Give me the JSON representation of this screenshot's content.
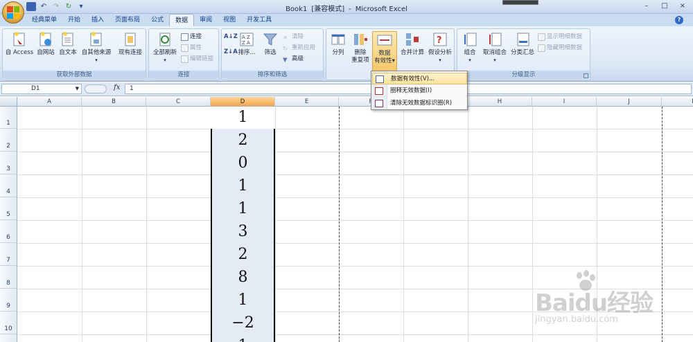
{
  "window": {
    "title_book": "Book1",
    "title_mode": "[兼容模式]",
    "title_sep": "-",
    "title_app": "Microsoft Excel",
    "controls": [
      "–",
      "□",
      "×"
    ]
  },
  "tabs": [
    {
      "label": "经典菜单",
      "active": false
    },
    {
      "label": "开始",
      "active": false
    },
    {
      "label": "插入",
      "active": false
    },
    {
      "label": "页面布局",
      "active": false
    },
    {
      "label": "公式",
      "active": false
    },
    {
      "label": "数据",
      "active": true
    },
    {
      "label": "审阅",
      "active": false
    },
    {
      "label": "视图",
      "active": false
    },
    {
      "label": "开发工具",
      "active": false
    }
  ],
  "ribbon": {
    "get_external": {
      "label": "获取外部数据",
      "access": "自 Access",
      "web": "自网站",
      "text": "自文本",
      "other": "自其他来源",
      "existing": "现有连接"
    },
    "connections": {
      "label": "连接",
      "refresh_all": "全部刷新",
      "connections": "连接",
      "properties": "属性",
      "edit_links": "编辑链接"
    },
    "sort_filter": {
      "label": "排序和筛选",
      "sort": "排序...",
      "filter": "筛选",
      "clear": "清除",
      "reapply": "重新应用",
      "advanced": "高级"
    },
    "data_tools": {
      "split": "分列",
      "remove_dup_1": "删除",
      "remove_dup_2": "重复项",
      "validation_1": "数据",
      "validation_2": "有效性",
      "consolidate": "合并计算",
      "whatif": "假设分析"
    },
    "outline": {
      "label": "分级显示",
      "group": "组合",
      "ungroup": "取消组合",
      "subtotal": "分类汇总",
      "show_detail": "显示明细数据",
      "hide_detail": "隐藏明细数据"
    }
  },
  "formula_bar": {
    "name_box": "D1",
    "fx": "fx",
    "value": "1"
  },
  "columns": [
    "A",
    "B",
    "C",
    "D",
    "E",
    "F",
    "G",
    "H",
    "I",
    "J",
    "K"
  ],
  "rows": [
    "1",
    "2",
    "3",
    "4",
    "5",
    "6",
    "7",
    "8",
    "9",
    "10"
  ],
  "d_values": [
    "1",
    "2",
    "0",
    "1",
    "1",
    "3",
    "2",
    "8",
    "1",
    "−2",
    "1"
  ],
  "menu": {
    "items": [
      "数据有效性(V)...",
      "圈释无效数据(I)",
      "清除无效数据标识圈(R)"
    ]
  },
  "watermark": {
    "brand": "Baidu经验",
    "url": "jingyan.baidu.com"
  }
}
